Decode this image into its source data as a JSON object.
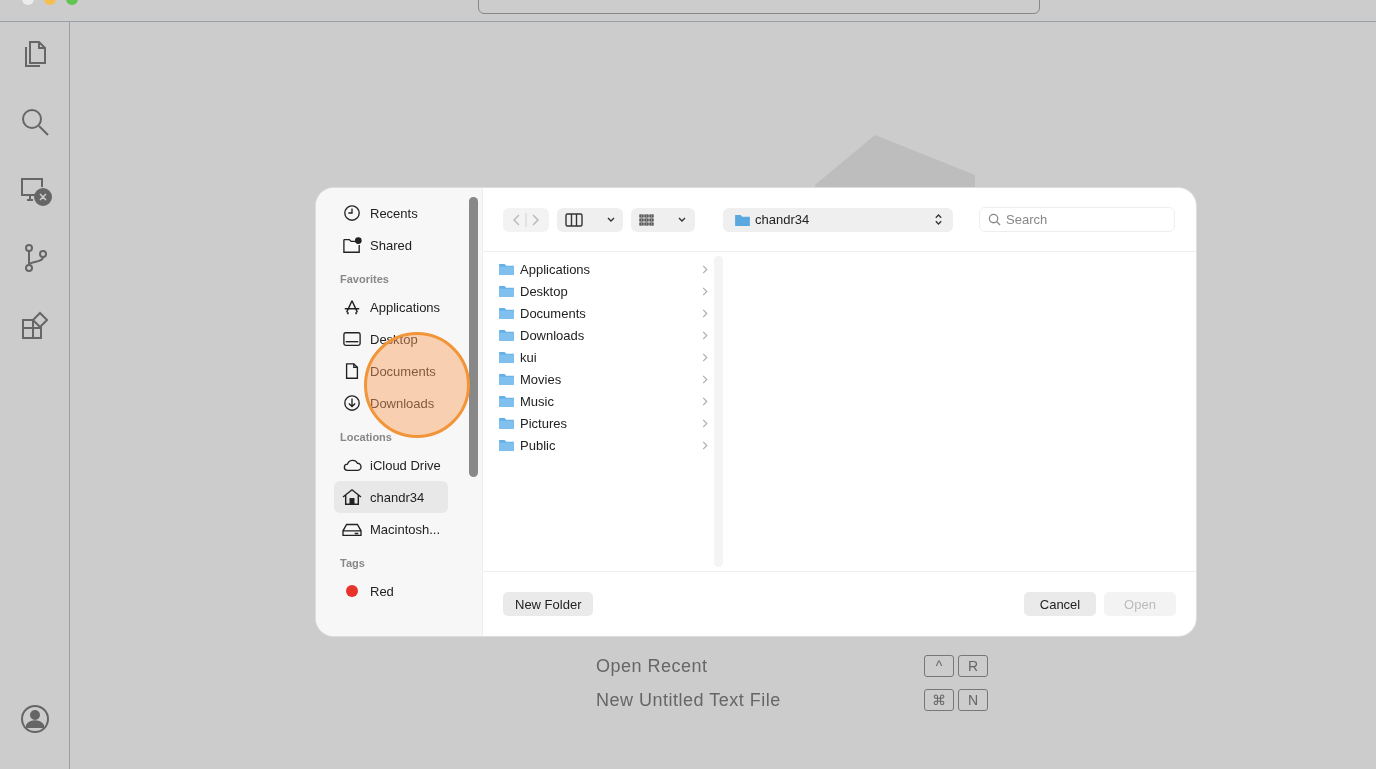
{
  "welcome": {
    "shortcuts": [
      {
        "label": "Open Recent",
        "keys": [
          "^",
          "R"
        ]
      },
      {
        "label": "New Untitled Text File",
        "keys": [
          "⌘",
          "N"
        ]
      }
    ]
  },
  "dialog": {
    "sidebar": {
      "sections": [
        {
          "items": [
            {
              "label": "Recents",
              "kind": "clock",
              "selected": false
            },
            {
              "label": "Shared",
              "kind": "shared",
              "selected": false
            }
          ]
        },
        {
          "heading": "Favorites",
          "items": [
            {
              "label": "Applications",
              "kind": "apps",
              "selected": false
            },
            {
              "label": "Desktop",
              "kind": "desktop",
              "selected": false
            },
            {
              "label": "Documents",
              "kind": "doc",
              "selected": false
            },
            {
              "label": "Downloads",
              "kind": "download",
              "selected": false
            }
          ]
        },
        {
          "heading": "Locations",
          "items": [
            {
              "label": "iCloud Drive",
              "kind": "cloud",
              "selected": false
            },
            {
              "label": "chandr34",
              "kind": "home",
              "selected": true
            },
            {
              "label": "Macintosh...",
              "kind": "disk",
              "selected": false
            }
          ]
        },
        {
          "heading": "Tags",
          "items": [
            {
              "label": "Red",
              "kind": "tag",
              "selected": false,
              "color": "#e8322a"
            }
          ]
        }
      ]
    },
    "path_popup": "chandr34",
    "search": {
      "placeholder": "Search"
    },
    "files": [
      "Applications",
      "Desktop",
      "Documents",
      "Downloads",
      "kui",
      "Movies",
      "Music",
      "Pictures",
      "Public"
    ],
    "buttons": [
      {
        "label": "New Folder",
        "kind": "left",
        "disabled": false
      },
      {
        "label": "Cancel",
        "kind": "right",
        "disabled": false
      },
      {
        "label": "Open",
        "kind": "right",
        "disabled": true
      }
    ]
  }
}
